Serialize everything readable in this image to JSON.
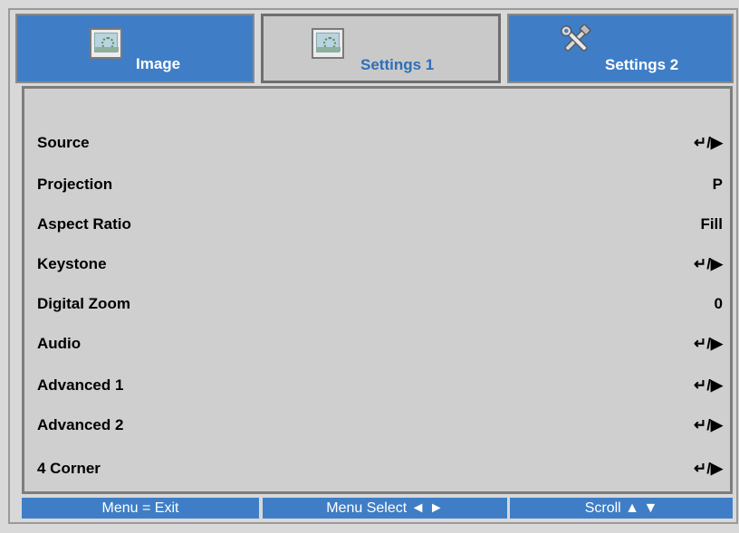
{
  "tabs": [
    {
      "label": "Image",
      "icon": "image-icon",
      "active": false
    },
    {
      "label": "Settings 1",
      "icon": "image-icon",
      "active": true
    },
    {
      "label": "Settings 2",
      "icon": "tools-icon",
      "active": false
    }
  ],
  "menu_items": [
    {
      "label": "Source",
      "value": "↵/▶"
    },
    {
      "label": "Projection",
      "value": "P"
    },
    {
      "label": "Aspect Ratio",
      "value": "Fill"
    },
    {
      "label": "Keystone",
      "value": "↵/▶"
    },
    {
      "label": "Digital Zoom",
      "value": "0"
    },
    {
      "label": "Audio",
      "value": "↵/▶"
    },
    {
      "label": "Advanced 1",
      "value": "↵/▶"
    },
    {
      "label": "Advanced 2",
      "value": "↵/▶"
    },
    {
      "label": "4 Corner",
      "value": "↵/▶"
    }
  ],
  "footer": {
    "exit": "Menu = Exit",
    "select": "Menu Select ◄ ►",
    "scroll": "Scroll ▲ ▼"
  },
  "colors": {
    "tab_blue": "#3f7ec6",
    "active_tab_text": "#2e6fb8",
    "panel_bg": "#cfcfcf"
  }
}
